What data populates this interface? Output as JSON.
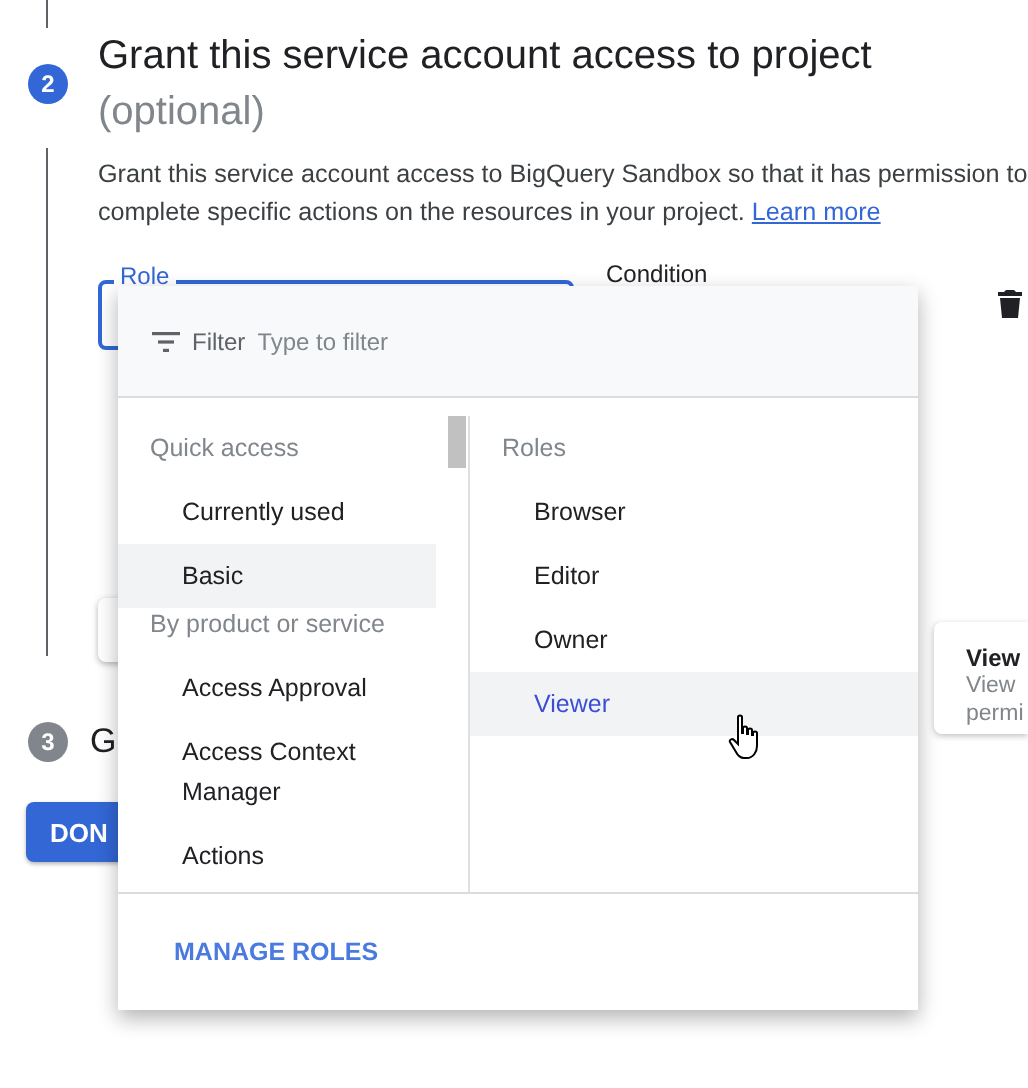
{
  "steps": [
    {
      "number": "2",
      "active": true,
      "title": "Grant this service account access to project",
      "subtitle": "(optional)",
      "description": "Grant this service account access to BigQuery Sandbox so that it has permission to complete specific actions on the resources in your project.",
      "link": "Learn more"
    },
    {
      "number": "3",
      "active": false,
      "title_start": "G"
    }
  ],
  "role_field": {
    "label": "Role"
  },
  "condition_label": "Condition",
  "done_button": "DON",
  "role_menu": {
    "filter_label": "Filter",
    "filter_placeholder": "Type to filter",
    "groups": [
      {
        "heading": "Quick access",
        "items": [
          {
            "label": "Currently used",
            "selected": false
          },
          {
            "label": "Basic",
            "selected": true
          }
        ]
      },
      {
        "heading": "By product or service",
        "items": [
          {
            "label": "Access Approval",
            "selected": false
          },
          {
            "label": "Access Context Manager",
            "selected": false
          },
          {
            "label": "Actions",
            "selected": false
          }
        ]
      }
    ],
    "roles_heading": "Roles",
    "roles": [
      {
        "label": "Browser",
        "selected": false
      },
      {
        "label": "Editor",
        "selected": false
      },
      {
        "label": "Owner",
        "selected": false
      },
      {
        "label": "Viewer",
        "selected": true
      }
    ],
    "footer_button": "MANAGE ROLES"
  },
  "tooltip": {
    "title": "View",
    "lines": [
      "View",
      "permi"
    ]
  }
}
